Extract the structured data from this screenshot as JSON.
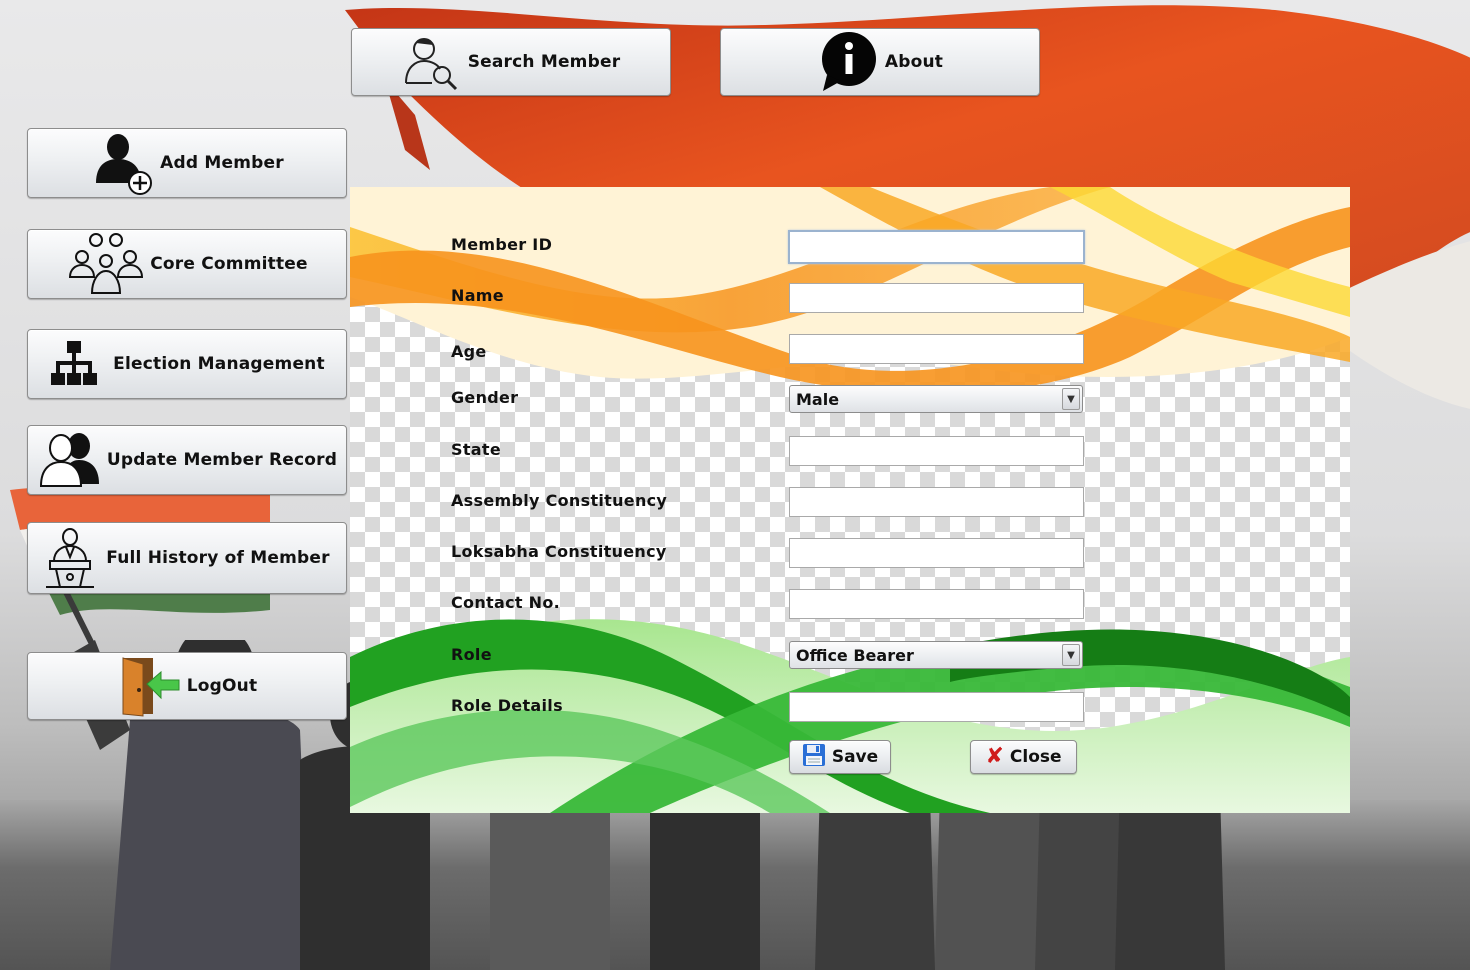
{
  "top_buttons": {
    "search_member": "Search Member",
    "about": "About"
  },
  "sidebar": {
    "items": [
      {
        "label": "Add Member",
        "icon": "add-person-icon"
      },
      {
        "label": "Core Committee",
        "icon": "group-icon"
      },
      {
        "label": "Election Management",
        "icon": "hierarchy-icon"
      },
      {
        "label": "Update Member Record",
        "icon": "users-icon"
      },
      {
        "label": "Full History of Member",
        "icon": "speaker-podium-icon"
      },
      {
        "label": "LogOut",
        "icon": "exit-door-icon"
      }
    ]
  },
  "form": {
    "labels": {
      "member_id": "Member ID",
      "name": "Name",
      "age": "Age",
      "gender": "Gender",
      "state": "State",
      "assembly": "Assembly Constituency",
      "loksabha": "Loksabha Constituency",
      "contact": "Contact No.",
      "role": "Role",
      "role_details": "Role Details"
    },
    "values": {
      "member_id": "",
      "name": "",
      "age": "",
      "state": "",
      "assembly": "",
      "loksabha": "",
      "contact": "",
      "role_details": ""
    },
    "gender_selected": "Male",
    "role_selected": "Office Bearer",
    "save_label": "Save",
    "close_label": "Close"
  },
  "colors": {
    "saffron": "#f7941d",
    "green": "#2ca02c",
    "flag_red": "#e0441b",
    "button_face": "#eef0f2"
  }
}
